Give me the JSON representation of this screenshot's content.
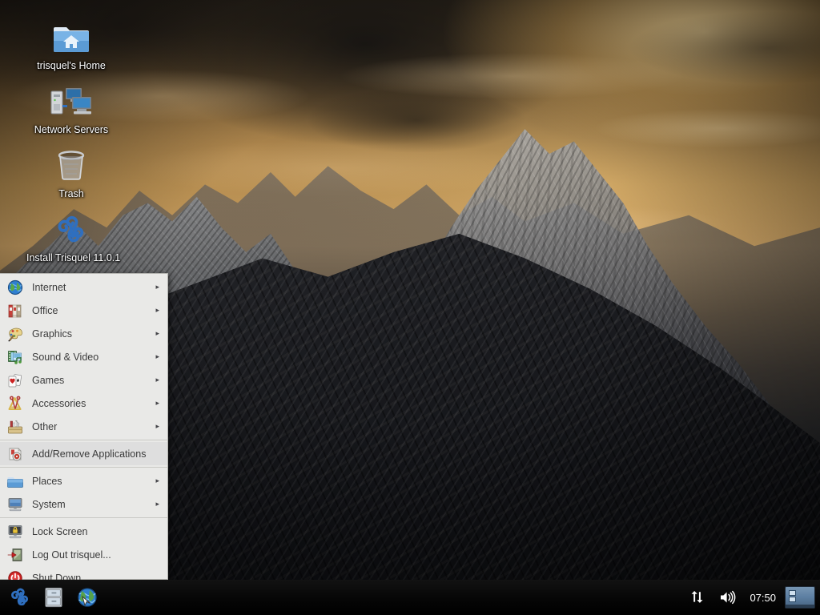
{
  "desktop": {
    "icons": [
      {
        "name": "home-folder",
        "label": "trisquel's Home",
        "icon": "home-folder-icon"
      },
      {
        "name": "network-servers",
        "label": "Network Servers",
        "icon": "network-servers-icon"
      },
      {
        "name": "trash",
        "label": "Trash",
        "icon": "trash-icon"
      },
      {
        "name": "install-trisquel",
        "label": "Install Trisquel 11.0.1",
        "icon": "trisquel-logo-icon"
      }
    ]
  },
  "menu": {
    "items": [
      {
        "label": "Internet",
        "icon": "globe-icon",
        "submenu": true,
        "separator_after": false,
        "highlight": false
      },
      {
        "label": "Office",
        "icon": "binders-icon",
        "submenu": true,
        "separator_after": false,
        "highlight": false
      },
      {
        "label": "Graphics",
        "icon": "palette-icon",
        "submenu": true,
        "separator_after": false,
        "highlight": false
      },
      {
        "label": "Sound & Video",
        "icon": "media-icon",
        "submenu": true,
        "separator_after": false,
        "highlight": false
      },
      {
        "label": "Games",
        "icon": "cards-icon",
        "submenu": true,
        "separator_after": false,
        "highlight": false
      },
      {
        "label": "Accessories",
        "icon": "compass-ruler-icon",
        "submenu": true,
        "separator_after": false,
        "highlight": false
      },
      {
        "label": "Other",
        "icon": "toolbox-icon",
        "submenu": true,
        "separator_after": true,
        "highlight": false
      },
      {
        "label": "Add/Remove Applications",
        "icon": "package-cd-icon",
        "submenu": false,
        "separator_after": true,
        "highlight": true
      },
      {
        "label": "Places",
        "icon": "folder-icon",
        "submenu": true,
        "separator_after": false,
        "highlight": false
      },
      {
        "label": "System",
        "icon": "monitor-icon",
        "submenu": true,
        "separator_after": true,
        "highlight": false
      },
      {
        "label": "Lock Screen",
        "icon": "lock-screen-icon",
        "submenu": false,
        "separator_after": false,
        "highlight": false
      },
      {
        "label": "Log Out trisquel...",
        "icon": "logout-icon",
        "submenu": false,
        "separator_after": false,
        "highlight": false
      },
      {
        "label": "Shut Down...",
        "icon": "power-icon",
        "submenu": false,
        "separator_after": false,
        "highlight": false
      }
    ],
    "submenu_arrow": "▸"
  },
  "taskbar": {
    "launchers": [
      {
        "name": "applications-menu-button",
        "icon": "trisquel-logo-icon",
        "title": "Applications Menu"
      },
      {
        "name": "file-manager-button",
        "icon": "file-cabinet-icon",
        "title": "File Manager"
      },
      {
        "name": "web-browser-button",
        "icon": "web-browser-icon",
        "title": "Web Browser"
      }
    ],
    "tray": [
      {
        "name": "network-tray-icon",
        "icon": "network-updown-icon"
      },
      {
        "name": "volume-tray-icon",
        "icon": "speaker-icon"
      }
    ],
    "clock": "07:50",
    "pager": {
      "name": "workspace-switcher",
      "workspaces": 1
    }
  },
  "colors": {
    "menu_background": "#e9e9e7",
    "menu_text": "#3b3b3b",
    "menu_highlight": "#dedede",
    "taskbar_background": "#060606",
    "desktop_label_text": "#ffffff",
    "trisquel_blue": "#2f6fbf"
  }
}
